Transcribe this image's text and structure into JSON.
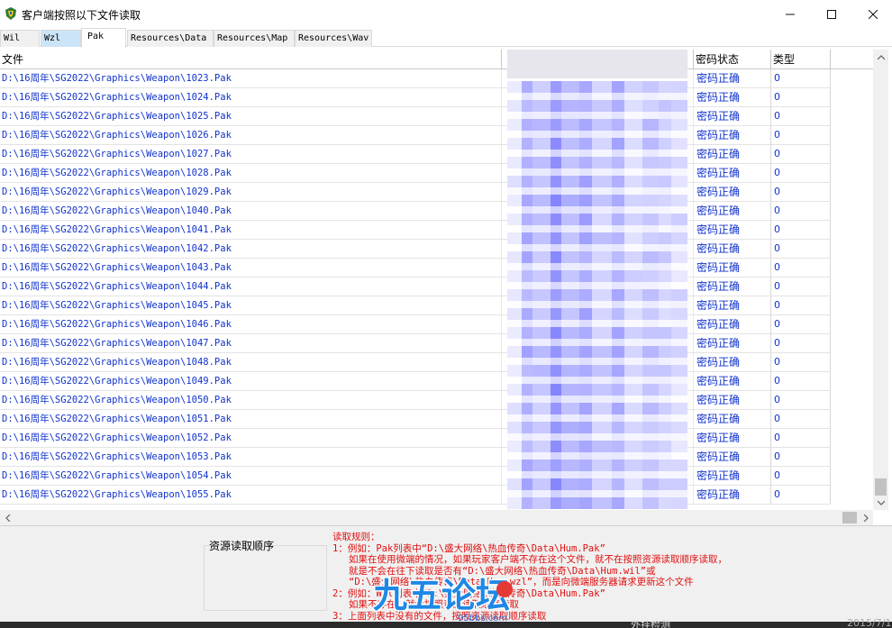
{
  "window": {
    "title": "客户端按照以下文件读取",
    "minimize_icon": "minimize-icon",
    "maximize_icon": "maximize-icon",
    "close_icon": "close-icon"
  },
  "tabs": [
    {
      "label": "Wil"
    },
    {
      "label": "Wzl"
    },
    {
      "label": "Pak"
    },
    {
      "label": "Resources\\Data"
    },
    {
      "label": "Resources\\Map"
    },
    {
      "label": "Resources\\Wav"
    }
  ],
  "active_tab": "Pak",
  "table": {
    "columns": {
      "file": "文件",
      "password": "",
      "status": "密码状态",
      "type": "类型"
    },
    "rows": [
      {
        "file": "D:\\16周年\\SG2022\\Graphics\\Weapon\\1023.Pak",
        "status": "密码正确",
        "type": "0"
      },
      {
        "file": "D:\\16周年\\SG2022\\Graphics\\Weapon\\1024.Pak",
        "status": "密码正确",
        "type": "0"
      },
      {
        "file": "D:\\16周年\\SG2022\\Graphics\\Weapon\\1025.Pak",
        "status": "密码正确",
        "type": "0"
      },
      {
        "file": "D:\\16周年\\SG2022\\Graphics\\Weapon\\1026.Pak",
        "status": "密码正确",
        "type": "0"
      },
      {
        "file": "D:\\16周年\\SG2022\\Graphics\\Weapon\\1027.Pak",
        "status": "密码正确",
        "type": "0"
      },
      {
        "file": "D:\\16周年\\SG2022\\Graphics\\Weapon\\1028.Pak",
        "status": "密码正确",
        "type": "0"
      },
      {
        "file": "D:\\16周年\\SG2022\\Graphics\\Weapon\\1029.Pak",
        "status": "密码正确",
        "type": "0"
      },
      {
        "file": "D:\\16周年\\SG2022\\Graphics\\Weapon\\1040.Pak",
        "status": "密码正确",
        "type": "0"
      },
      {
        "file": "D:\\16周年\\SG2022\\Graphics\\Weapon\\1041.Pak",
        "status": "密码正确",
        "type": "0"
      },
      {
        "file": "D:\\16周年\\SG2022\\Graphics\\Weapon\\1042.Pak",
        "status": "密码正确",
        "type": "0"
      },
      {
        "file": "D:\\16周年\\SG2022\\Graphics\\Weapon\\1043.Pak",
        "status": "密码正确",
        "type": "0"
      },
      {
        "file": "D:\\16周年\\SG2022\\Graphics\\Weapon\\1044.Pak",
        "status": "密码正确",
        "type": "0"
      },
      {
        "file": "D:\\16周年\\SG2022\\Graphics\\Weapon\\1045.Pak",
        "status": "密码正确",
        "type": "0"
      },
      {
        "file": "D:\\16周年\\SG2022\\Graphics\\Weapon\\1046.Pak",
        "status": "密码正确",
        "type": "0"
      },
      {
        "file": "D:\\16周年\\SG2022\\Graphics\\Weapon\\1047.Pak",
        "status": "密码正确",
        "type": "0"
      },
      {
        "file": "D:\\16周年\\SG2022\\Graphics\\Weapon\\1048.Pak",
        "status": "密码正确",
        "type": "0"
      },
      {
        "file": "D:\\16周年\\SG2022\\Graphics\\Weapon\\1049.Pak",
        "status": "密码正确",
        "type": "0"
      },
      {
        "file": "D:\\16周年\\SG2022\\Graphics\\Weapon\\1050.Pak",
        "status": "密码正确",
        "type": "0"
      },
      {
        "file": "D:\\16周年\\SG2022\\Graphics\\Weapon\\1051.Pak",
        "status": "密码正确",
        "type": "0"
      },
      {
        "file": "D:\\16周年\\SG2022\\Graphics\\Weapon\\1052.Pak",
        "status": "密码正确",
        "type": "0"
      },
      {
        "file": "D:\\16周年\\SG2022\\Graphics\\Weapon\\1053.Pak",
        "status": "密码正确",
        "type": "0"
      },
      {
        "file": "D:\\16周年\\SG2022\\Graphics\\Weapon\\1054.Pak",
        "status": "密码正确",
        "type": "0"
      },
      {
        "file": "D:\\16周年\\SG2022\\Graphics\\Weapon\\1055.Pak",
        "status": "密码正确",
        "type": "0"
      }
    ]
  },
  "bottom": {
    "order_label": "资源读取顺序",
    "rules_lines": [
      "读取规则：",
      "1：例如：Pak列表中“D:\\盛大网络\\热血传奇\\Data\\Hum.Pak”",
      "如果在使用微端的情况，如果玩家客户端不存在这个文件，就不在按照资源读取顺序读取，",
      "就是不会在往下读取是否有“D:\\盛大网络\\热血传奇\\Data\\Hum.wil”或",
      "“D:\\盛大网络\\热血传奇\\Data\\Hum.wzl”，而是向微端服务器请求更新这个文件",
      "2：例如：Wil列表中“D:\\盛大网络\\热血传奇\\Data\\Hum.Pak”",
      "如果不存在，就会按照资源读取顺序读取",
      "3：上面列表中没有的文件，按照资源读取顺序读取"
    ]
  },
  "watermark": {
    "brand": "九五论坛",
    "site": "95bbs.com"
  },
  "background_window": {
    "text1": "外挂检测",
    "text2": "2015/7/1"
  },
  "colors": {
    "link_blue": "#1133cc",
    "rule_red": "#e01010",
    "tab_highlight": "#cce4f7"
  }
}
